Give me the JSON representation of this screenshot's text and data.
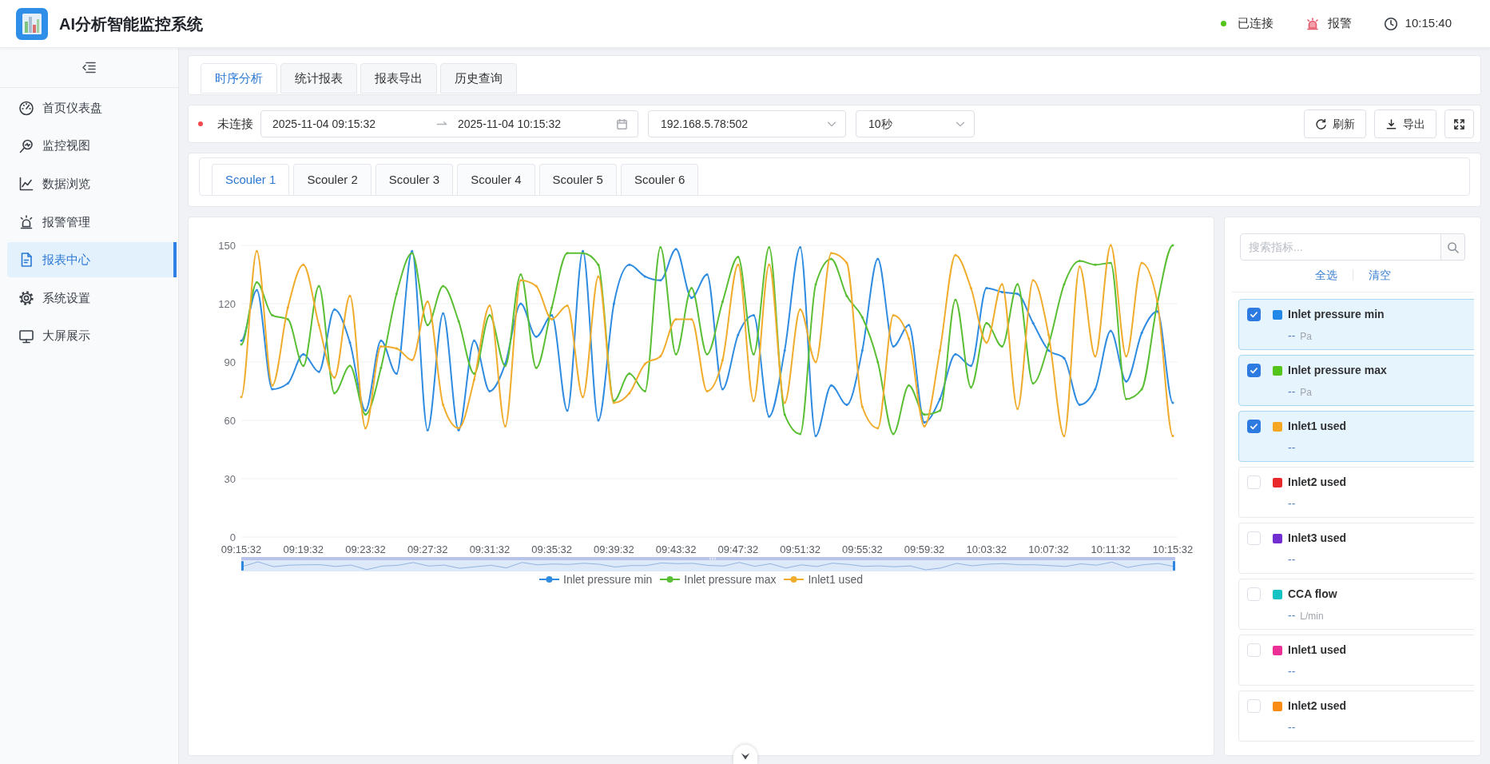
{
  "header": {
    "title": "AI分析智能监控系统",
    "connection": {
      "label": "已连接",
      "connected": true
    },
    "alarm": {
      "label": "报警"
    },
    "time": "10:15:40"
  },
  "sidebar": {
    "items": [
      {
        "label": "首页仪表盘",
        "selected": false
      },
      {
        "label": "监控视图",
        "selected": false
      },
      {
        "label": "数据浏览",
        "selected": false
      },
      {
        "label": "报警管理",
        "selected": false
      },
      {
        "label": "报表中心",
        "selected": true
      },
      {
        "label": "系统设置",
        "selected": false
      },
      {
        "label": "大屏展示",
        "selected": false
      }
    ]
  },
  "tabs": [
    {
      "label": "时序分析",
      "selected": true
    },
    {
      "label": "统计报表",
      "selected": false
    },
    {
      "label": "报表导出",
      "selected": false
    },
    {
      "label": "历史查询",
      "selected": false
    }
  ],
  "toolbar": {
    "status": {
      "label": "未连接",
      "connected": false
    },
    "date_range": {
      "start": "2025-11-04 09:15:32",
      "end": "2025-11-04 10:15:32"
    },
    "address": "192.168.5.78:502",
    "interval": "10秒",
    "buttons": [
      {
        "label": "刷新"
      },
      {
        "label": "导出"
      }
    ]
  },
  "device_tabs": [
    {
      "label": "Scouler 1",
      "selected": true
    },
    {
      "label": "Scouler 2",
      "selected": false
    },
    {
      "label": "Scouler 3",
      "selected": false
    },
    {
      "label": "Scouler 4",
      "selected": false
    },
    {
      "label": "Scouler 5",
      "selected": false
    },
    {
      "label": "Scouler 6",
      "selected": false
    }
  ],
  "chart": {
    "chart_data": {
      "type": "line",
      "categories": [
        "09:15:32",
        null,
        null,
        null,
        "09:19:32",
        null,
        null,
        null,
        "09:23:32",
        null,
        null,
        null,
        "09:27:32",
        null,
        null,
        null,
        "09:31:32",
        null,
        null,
        null,
        "09:35:32",
        null,
        null,
        null,
        "09:39:32",
        null,
        null,
        null,
        "09:43:32",
        null,
        null,
        null,
        "09:47:32",
        null,
        null,
        null,
        "09:51:32",
        null,
        null,
        null,
        "09:55:32",
        null,
        null,
        null,
        "09:59:32",
        null,
        null,
        null,
        "10:03:32",
        null,
        null,
        null,
        "10:07:32",
        null,
        null,
        null,
        "10:11:32",
        null,
        null,
        null,
        "10:15:32"
      ],
      "ylim": [
        0,
        150
      ],
      "yticks": [
        0,
        30,
        60,
        90,
        120,
        150
      ],
      "grid": true,
      "legend": "bottom",
      "series": [
        {
          "name": "Inlet pressure min",
          "color": "#2f8ce0",
          "values": [
            101,
            127,
            76,
            79,
            94,
            85,
            117,
            100,
            65,
            101,
            84,
            147,
            55,
            115,
            55,
            101,
            75,
            89,
            120,
            103,
            114,
            65,
            147,
            60,
            120,
            140,
            134,
            132,
            148,
            123,
            135,
            76,
            104,
            114,
            62,
            96,
            149,
            52,
            78,
            68,
            96,
            143,
            98,
            109,
            59,
            71,
            94,
            88,
            128,
            126,
            125,
            110,
            96,
            92,
            68,
            76,
            106,
            80,
            105,
            116,
            69
          ]
        },
        {
          "name": "Inlet pressure max",
          "color": "#5bbf35",
          "values": [
            99,
            131,
            114,
            112,
            88,
            129,
            74,
            88,
            63,
            87,
            125,
            146,
            109,
            129,
            111,
            84,
            114,
            88,
            135,
            87,
            118,
            146,
            146,
            140,
            70,
            84,
            75,
            149,
            94,
            128,
            94,
            121,
            144,
            94,
            149,
            63,
            53,
            130,
            143,
            124,
            113,
            90,
            53,
            78,
            63,
            65,
            122,
            77,
            110,
            98,
            130,
            79,
            99,
            130,
            142,
            140,
            141,
            71,
            76,
            120,
            150
          ]
        },
        {
          "name": "Inlet1 used",
          "color": "#f0ac2c",
          "values": [
            72,
            147,
            78,
            118,
            140,
            109,
            82,
            124,
            56,
            98,
            97,
            91,
            121,
            68,
            56,
            81,
            119,
            57,
            132,
            129,
            112,
            119,
            72,
            134,
            69,
            74,
            89,
            93,
            112,
            112,
            75,
            91,
            140,
            70,
            140,
            69,
            117,
            90,
            146,
            141,
            67,
            56,
            114,
            102,
            57,
            96,
            145,
            128,
            100,
            130,
            66,
            132,
            104,
            52,
            139,
            93,
            150,
            93,
            141,
            121,
            52
          ]
        }
      ]
    }
  },
  "metrics": {
    "search": {
      "placeholder": "搜索指标..."
    },
    "actions": [
      "全选",
      "清空"
    ],
    "items": [
      {
        "name": "Inlet pressure min",
        "color": "#2188e8",
        "checked": true,
        "value": "--",
        "unit": "Pa"
      },
      {
        "name": "Inlet pressure max",
        "color": "#52c41a",
        "checked": true,
        "value": "--",
        "unit": "Pa"
      },
      {
        "name": "Inlet1 used",
        "color": "#f5a623",
        "checked": true,
        "value": "--"
      },
      {
        "name": "Inlet2 used",
        "color": "#e8282b",
        "checked": false,
        "value": "--"
      },
      {
        "name": "Inlet3 used",
        "color": "#722ed1",
        "checked": false,
        "value": "--"
      },
      {
        "name": "CCA flow",
        "color": "#13c2c2",
        "checked": false,
        "value": "--",
        "unit": "L/min"
      },
      {
        "name": "Inlet1 used",
        "color": "#eb2f96",
        "checked": false,
        "value": "--"
      },
      {
        "name": "Inlet2 used",
        "color": "#fa8c16",
        "checked": false,
        "value": "--"
      }
    ]
  }
}
